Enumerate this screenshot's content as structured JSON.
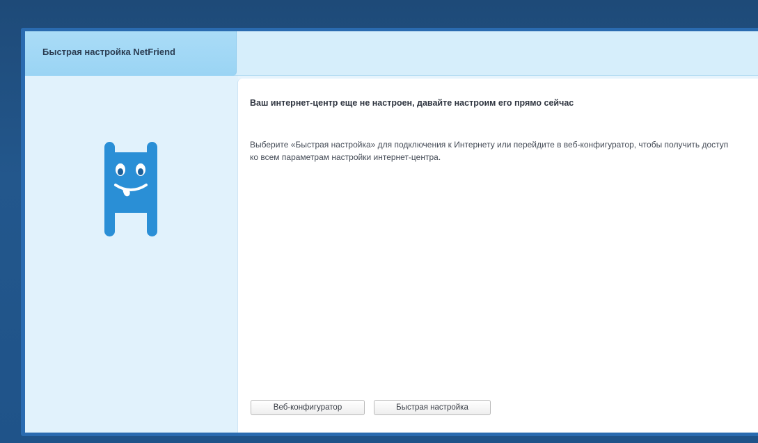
{
  "header": {
    "title": "Быстрая настройка NetFriend"
  },
  "sidebar": {
    "mascot_icon": "netfriend-mascot-icon"
  },
  "content": {
    "heading": "Ваш интернет-центр еще не настроен, давайте настроим его прямо сейчас",
    "description": "Выберите «Быстрая настройка» для подключения к Интернету или перейдите в веб-конфигуратор, чтобы получить доступ ко всем параметрам настройки интернет-центра."
  },
  "buttons": {
    "web_configurator": "Веб-конфигуратор",
    "quick_setup": "Быстрая настройка"
  },
  "colors": {
    "accent": "#2a8fd6",
    "header_tab": "#a6dbf6",
    "sidebar": "#e1f2fc",
    "background": "#1f5389"
  }
}
